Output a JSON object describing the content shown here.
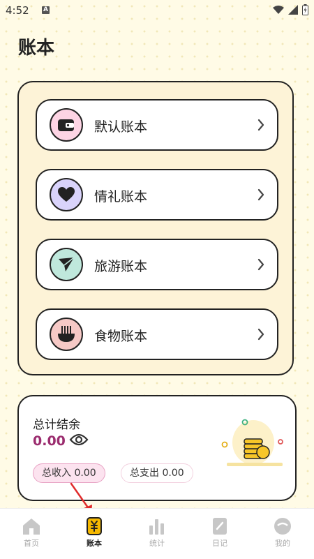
{
  "status_bar": {
    "time": "4:52",
    "indicator": "A"
  },
  "page": {
    "title": "账本"
  },
  "books": [
    {
      "label": "默认账本",
      "icon": "wallet-icon",
      "icon_bg": "#fdd4e4"
    },
    {
      "label": "情礼账本",
      "icon": "heart-icon",
      "icon_bg": "#d9d3fb"
    },
    {
      "label": "旅游账本",
      "icon": "paper-plane-icon",
      "icon_bg": "#bfe8dc"
    },
    {
      "label": "食物账本",
      "icon": "noodle-bowl-icon",
      "icon_bg": "#f6c9c6"
    }
  ],
  "summary": {
    "title": "总计结余",
    "balance": "0.00",
    "income_label": "总收入 0.00",
    "expense_label": "总支出 0.00"
  },
  "tabs": [
    {
      "label": "首页",
      "icon": "home-icon",
      "active": false
    },
    {
      "label": "账本",
      "icon": "ledger-icon",
      "active": true
    },
    {
      "label": "统计",
      "icon": "bar-chart-icon",
      "active": false
    },
    {
      "label": "日记",
      "icon": "diary-icon",
      "active": false
    },
    {
      "label": "我的",
      "icon": "profile-icon",
      "active": false
    }
  ],
  "colors": {
    "background": "#fffbe6",
    "panel": "#fdf3d7",
    "accent_balance": "#9b2d6f",
    "active_tab": "#f5b800"
  }
}
